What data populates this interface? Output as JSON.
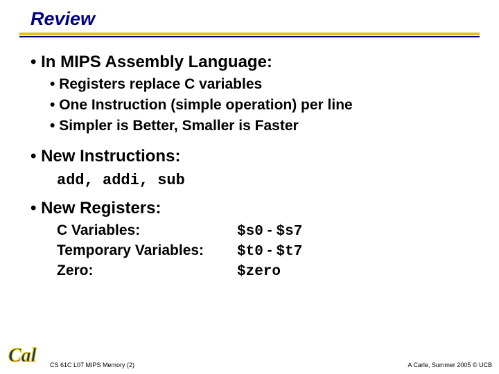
{
  "title": "Review",
  "bullets": {
    "b1": "In MIPS Assembly Language:",
    "b1_1": "Registers replace C variables",
    "b1_2": "One Instruction (simple operation) per line",
    "b1_3": "Simpler is Better, Smaller is Faster",
    "b2": "New Instructions:",
    "b2_code": "add, addi, sub",
    "b3": "New Registers:"
  },
  "registers": {
    "rows": [
      {
        "label": "C Variables:",
        "val_a": "$s0",
        "val_b": "$s7"
      },
      {
        "label": "Temporary Variables:",
        "val_a": "$t0",
        "val_b": "$t7"
      },
      {
        "label": "Zero:",
        "val_a": "$zero",
        "val_b": ""
      }
    ]
  },
  "footer": {
    "left": "CS 61C L07 MIPS Memory (2)",
    "right": "A Carle, Summer 2005 © UCB"
  },
  "logo_text": "Cal"
}
